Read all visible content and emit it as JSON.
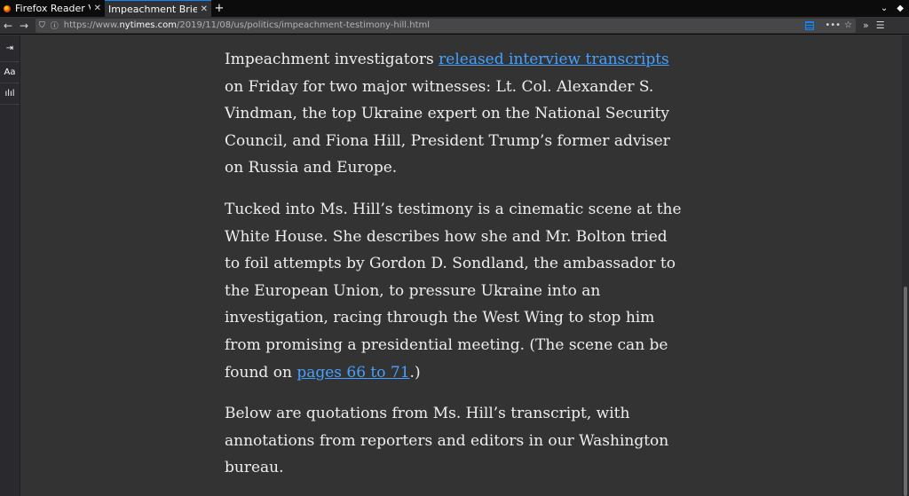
{
  "tabs": [
    {
      "title": "Firefox Reader Vi",
      "active": false
    },
    {
      "title": "Impeachment Briefi",
      "active": true
    }
  ],
  "url": {
    "scheme": "https://www.",
    "host": "nytimes.com",
    "path": "/2019/11/08/us/politics/impeachment-testimony-hill.html"
  },
  "sidebar": {
    "type_controls_label": "Aa"
  },
  "article": {
    "p1_link": "released interview transcripts",
    "p1_after": " on Friday for two major witnesses: Lt. Col. Alexander S. Vindman, the top Ukraine expert on the National Security Council, and Fiona Hill, President Trump’s former adviser on Russia and Europe.",
    "p1_before": "Impeachment investigators ",
    "p2_before": "Tucked into Ms. Hill’s testimony is a cinematic scene at the White House. She describes how she and Mr. Bolton tried to foil attempts by Gordon D. Sondland, the ambassador to the European Union, to pressure Ukraine into an investigation, racing through the West Wing to stop him from promising a presidential meeting. (The scene can be found on ",
    "p2_link": "pages 66 to 71",
    "p2_after": ".)",
    "p3": "Below are quotations from Ms. Hill’s transcript, with annotations from reporters and editors in our Washington bureau."
  },
  "colors": {
    "background": "#333333",
    "text": "#eeeeee",
    "link": "#45a1ff",
    "tab_accent": "#0a84ff"
  }
}
